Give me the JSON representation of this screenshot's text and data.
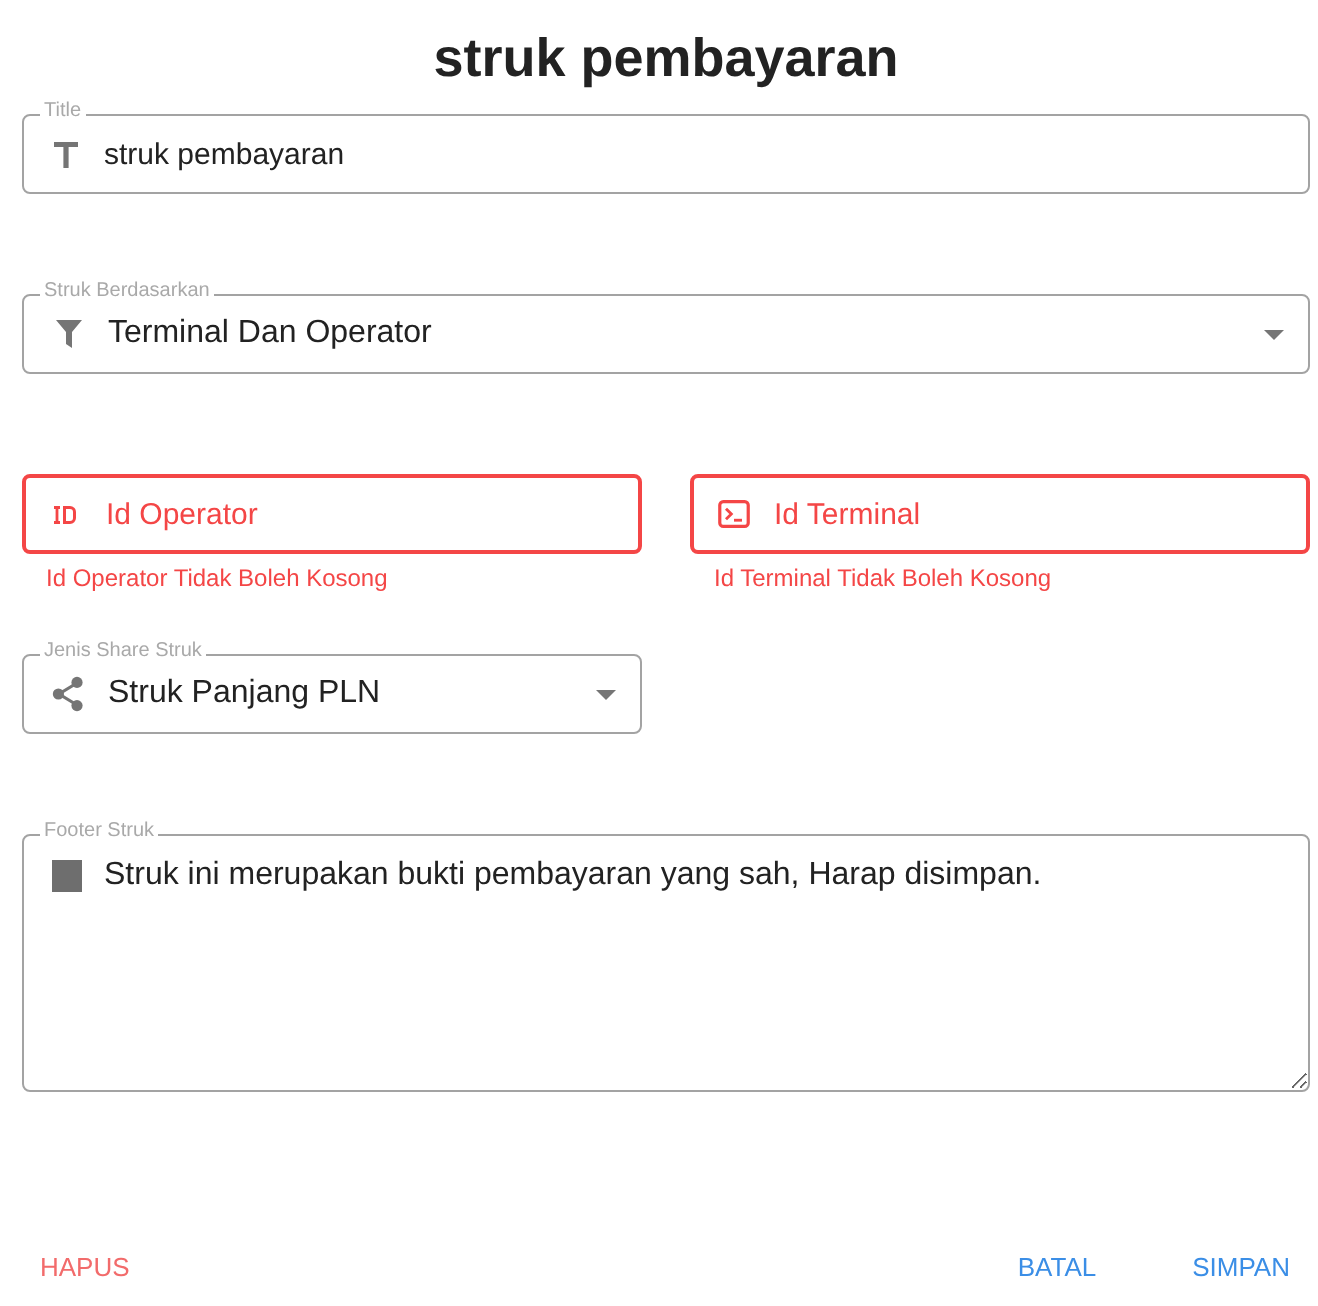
{
  "title": "struk pembayaran",
  "rows": [
    [
      {
        "kind": "text",
        "label": "Title",
        "value": "struk pembayaran",
        "error": false
      }
    ],
    [
      {
        "kind": "select",
        "label": "Struk Berdasarkan",
        "value": "Terminal Dan Operator",
        "error": false
      }
    ],
    [
      {
        "kind": "text",
        "placeholder": "Id Operator",
        "error": true,
        "error_text": "Id Operator Tidak Boleh Kosong"
      },
      {
        "kind": "text",
        "placeholder": "Id Terminal",
        "error": true,
        "error_text": "Id Terminal Tidak Boleh Kosong"
      }
    ],
    [
      {
        "kind": "select",
        "label": "Jenis Share Struk",
        "value": "Struk Panjang PLN",
        "error": false
      }
    ],
    [
      {
        "kind": "textarea",
        "label": "Footer Struk",
        "value": "Struk ini merupakan bukti pembayaran yang sah, Harap disimpan.",
        "error": false
      }
    ]
  ],
  "buttons": [
    {
      "label": "HAPUS",
      "kind": "danger"
    },
    {
      "label": "BATAL",
      "kind": "primary"
    },
    {
      "label": "SIMPAN",
      "kind": "primary"
    }
  ]
}
